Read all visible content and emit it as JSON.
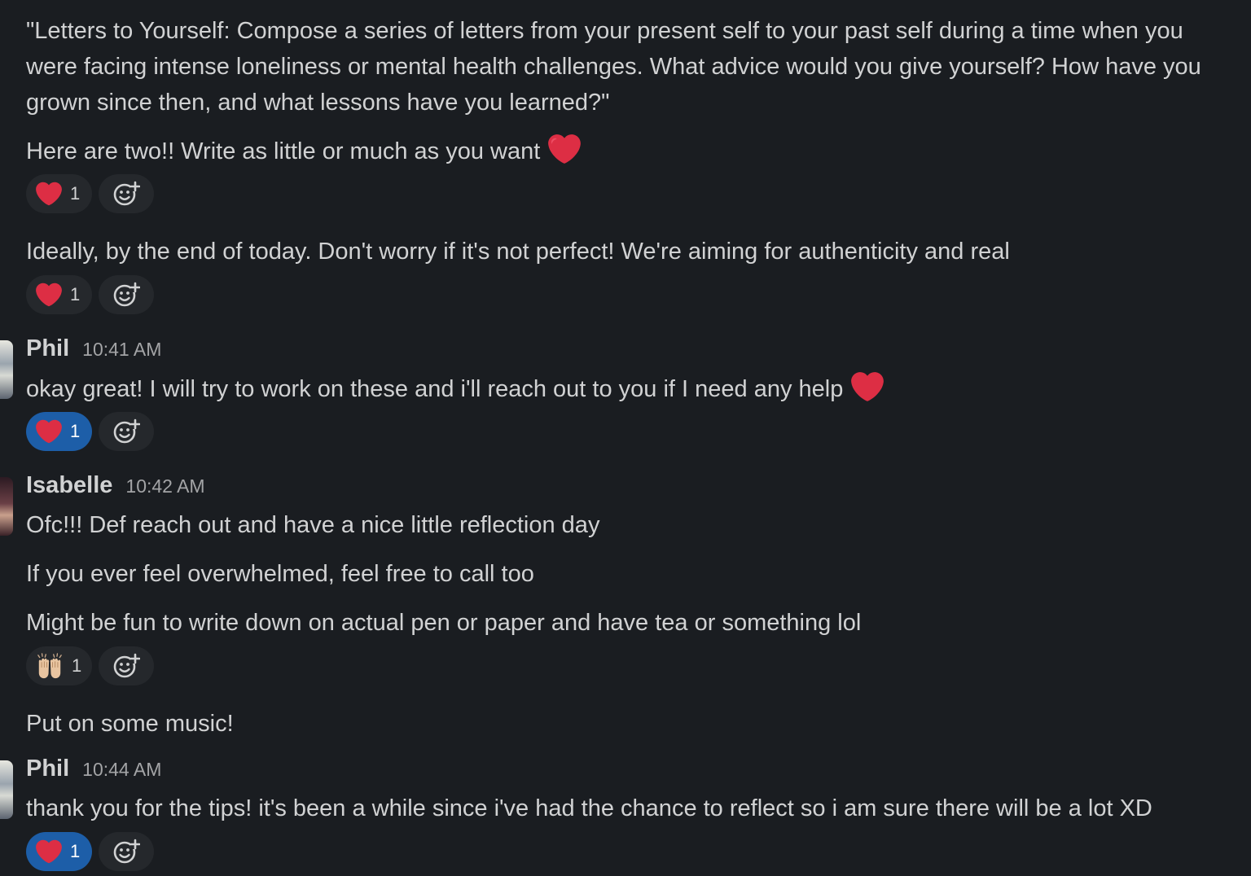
{
  "messages": {
    "m1": "\"Letters to Yourself: Compose a series of letters from your present self to your past self during a time when you were facing intense loneliness or mental health challenges. What advice would you give yourself? How have you grown since then, and what lessons have you learned?\"",
    "m2": "Here are two!! Write as little or much as you want",
    "m3": "Ideally, by the end of today. Don't worry if it's not perfect! We're aiming for authenticity and real",
    "m4": "okay great! I will try to work on these and i'll reach out to you if I need any help",
    "m5": "Ofc!!! Def reach out and have a nice little reflection day",
    "m6": "If you ever feel overwhelmed, feel free to call too",
    "m7": "Might be fun to write down on actual pen or paper and have tea or something lol",
    "m8": "Put on some music!",
    "m9": "thank you for the tips! it's been a while since i've had the chance to reflect so i am sure there will be a lot XD"
  },
  "headers": {
    "phil1": {
      "author": "Phil",
      "time": "10:41 AM"
    },
    "isabelle": {
      "author": "Isabelle",
      "time": "10:42 AM"
    },
    "phil2": {
      "author": "Phil",
      "time": "10:44 AM"
    }
  },
  "reactions": {
    "r1": {
      "emoji": "heart",
      "count": "1",
      "active": false
    },
    "r2": {
      "emoji": "heart",
      "count": "1",
      "active": false
    },
    "r3": {
      "emoji": "heart",
      "count": "1",
      "active": true
    },
    "r4": {
      "emoji": "raising-hands",
      "count": "1",
      "active": false
    },
    "r5": {
      "emoji": "heart",
      "count": "1",
      "active": true
    }
  },
  "colors": {
    "background": "#1a1d21",
    "text": "#d1d2d3",
    "reaction_pill": "#25282c",
    "reaction_active": "#1d5ea8",
    "heart": "#e0245e"
  }
}
